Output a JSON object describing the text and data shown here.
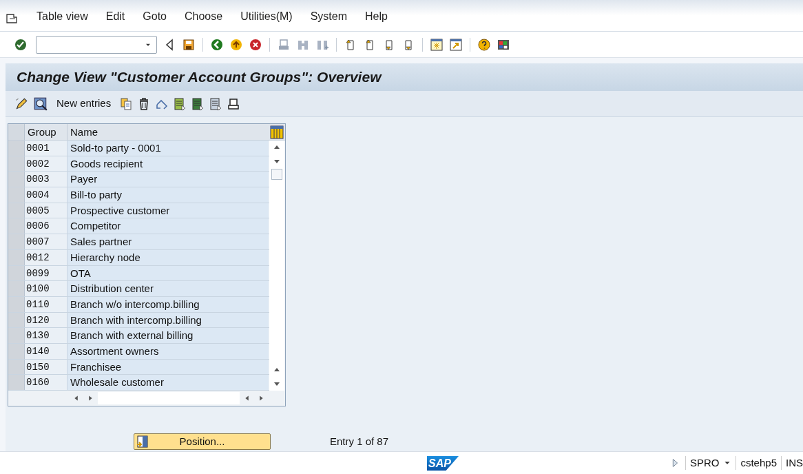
{
  "menu": [
    "Table view",
    "Edit",
    "Goto",
    "Choose",
    "Utilities(M)",
    "System",
    "Help"
  ],
  "title": "Change View \"Customer Account Groups\": Overview",
  "app_toolbar": {
    "new_entries": "New entries"
  },
  "table": {
    "columns": [
      "Group",
      "Name"
    ],
    "rows": [
      {
        "group": "0001",
        "name": "Sold-to party - 0001",
        "selected": false
      },
      {
        "group": "0002",
        "name": "Goods recipient",
        "selected": false
      },
      {
        "group": "0003",
        "name": "Payer",
        "selected": false
      },
      {
        "group": "0004",
        "name": "Bill-to party",
        "selected": false
      },
      {
        "group": "0005",
        "name": "Prospective customer",
        "selected": false
      },
      {
        "group": "0006",
        "name": "Competitor",
        "selected": false
      },
      {
        "group": "0007",
        "name": "Sales partner",
        "selected": false
      },
      {
        "group": "0012",
        "name": "Hierarchy node",
        "selected": false
      },
      {
        "group": "0099",
        "name": "OTA",
        "selected": false
      },
      {
        "group": "0100",
        "name": "Distribution center",
        "selected": false
      },
      {
        "group": "0110",
        "name": "Branch w/o intercomp.billing",
        "selected": false
      },
      {
        "group": "0120",
        "name": "Branch with intercomp.billing",
        "selected": false
      },
      {
        "group": "0130",
        "name": "Branch with external billing",
        "selected": false
      },
      {
        "group": "0140",
        "name": "Assortment owners",
        "selected": false
      },
      {
        "group": "0150",
        "name": "Franchisee",
        "selected": false
      },
      {
        "group": "0160",
        "name": "Wholesale customer",
        "selected": false
      }
    ]
  },
  "position_button": "Position...",
  "entry_info": "Entry 1 of 87",
  "status_bar": {
    "logo": "SAP",
    "transaction": "SPRO",
    "server": "cstehp5",
    "mode": "INS"
  }
}
